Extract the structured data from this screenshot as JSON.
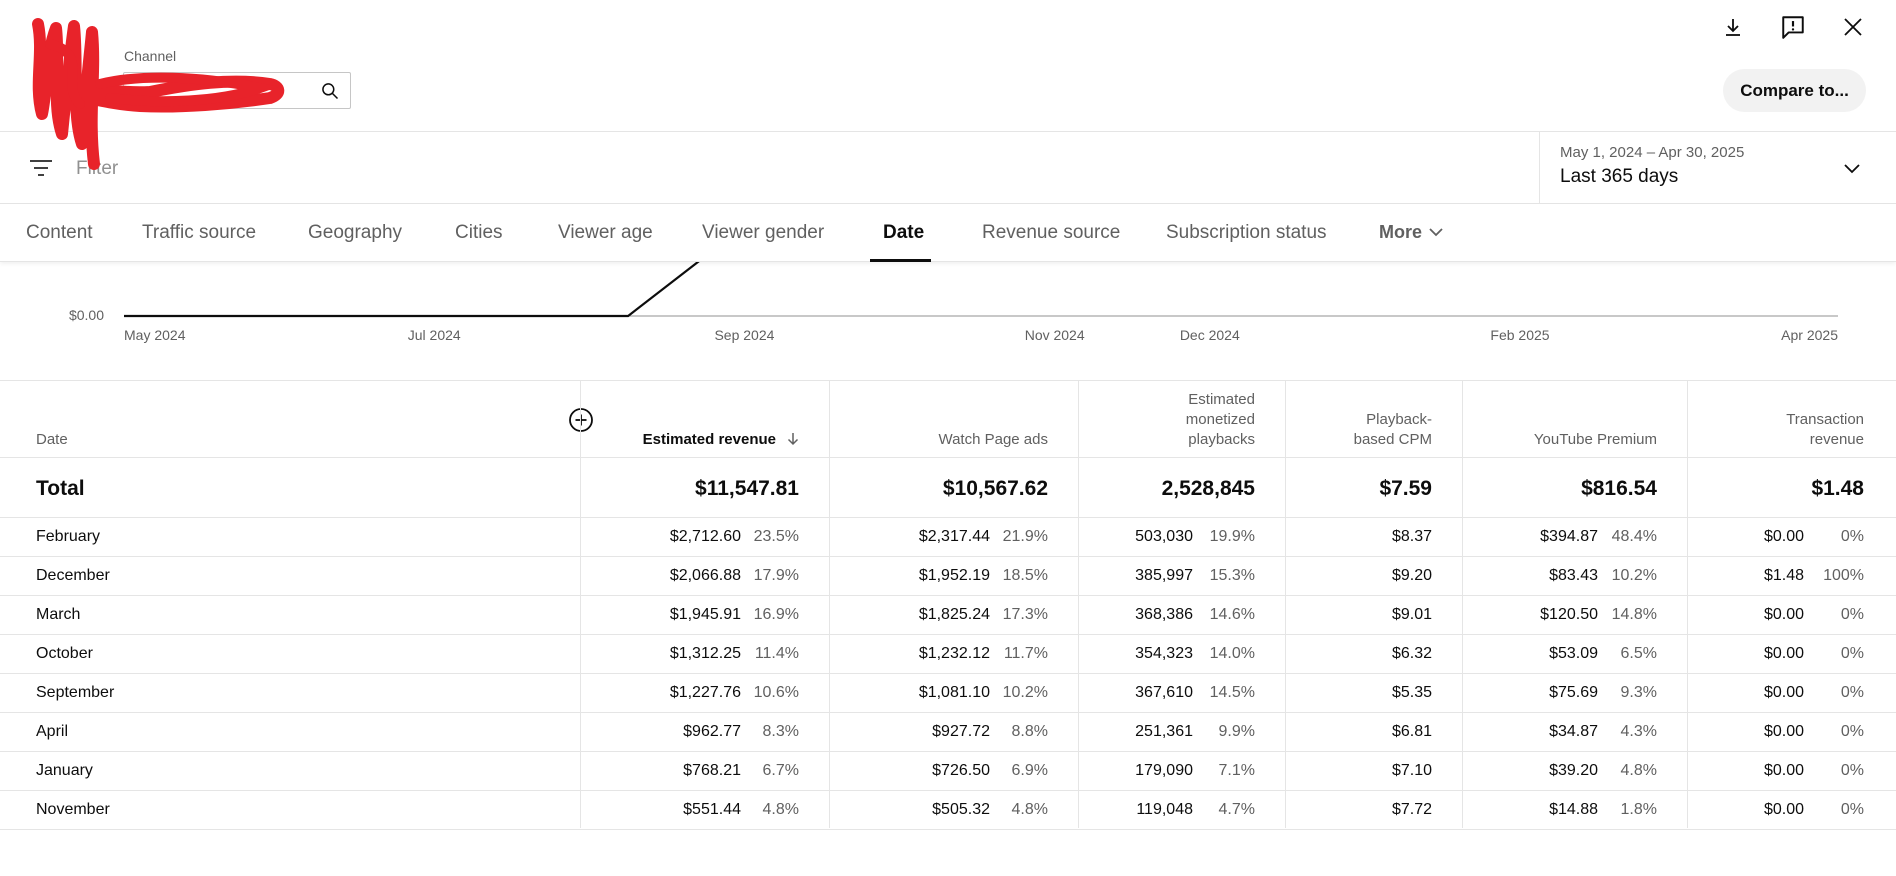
{
  "header": {
    "channel_label": "Channel",
    "channel_value": "",
    "compare_label": "Compare to..."
  },
  "icons": {
    "download": "download-icon",
    "feedback": "feedback-icon",
    "close": "close-icon",
    "search": "search-icon",
    "filter": "filter-icon",
    "chevron": "chevron-down-icon",
    "add_column": "add-circle-icon",
    "sort": "arrow-down-icon"
  },
  "filter": {
    "placeholder": "Filter"
  },
  "date_picker": {
    "range": "May 1, 2024 – Apr 30, 2025",
    "preset": "Last 365 days"
  },
  "tabs": [
    {
      "label": "Content"
    },
    {
      "label": "Traffic source"
    },
    {
      "label": "Geography"
    },
    {
      "label": "Cities"
    },
    {
      "label": "Viewer age"
    },
    {
      "label": "Viewer gender"
    },
    {
      "label": "Date",
      "active": true
    },
    {
      "label": "Revenue source"
    },
    {
      "label": "Subscription status"
    },
    {
      "label": "More"
    }
  ],
  "chart_data": {
    "type": "line",
    "y_tick_labels": [
      "$0.00"
    ],
    "x_tick_labels": [
      "May 2024",
      "Jul 2024",
      "Sep 2024",
      "Nov 2024",
      "Dec 2024",
      "Feb 2025",
      "Apr 2025"
    ],
    "series": [
      {
        "x": [
          "May 2024",
          "Aug 2024",
          "Sep 2024"
        ],
        "values": [
          0,
          0,
          1
        ]
      }
    ]
  },
  "table": {
    "columns": [
      {
        "label": "Date"
      },
      {
        "label": "Estimated revenue",
        "sorted": true
      },
      {
        "label": "Watch Page ads"
      },
      {
        "label": "Estimated monetized playbacks"
      },
      {
        "label": "Playback-based CPM"
      },
      {
        "label": "YouTube Premium"
      },
      {
        "label": "Transaction revenue"
      }
    ],
    "header_lines": {
      "date": [
        "Date"
      ],
      "est_rev": [
        "Estimated revenue"
      ],
      "watch": [
        "Watch Page ads"
      ],
      "playbacks": [
        "Estimated",
        "monetized",
        "playbacks"
      ],
      "cpm": [
        "Playback-",
        "based CPM"
      ],
      "premium": [
        "YouTube Premium"
      ],
      "transaction": [
        "Transaction",
        "revenue"
      ]
    },
    "total": {
      "label": "Total",
      "est_rev": "$11,547.81",
      "watch": "$10,567.62",
      "playbacks": "2,528,845",
      "cpm": "$7.59",
      "premium": "$816.54",
      "transaction": "$1.48"
    },
    "rows": [
      {
        "date": "February",
        "est_rev": "$2,712.60",
        "est_rev_pct": "23.5%",
        "watch": "$2,317.44",
        "watch_pct": "21.9%",
        "playbacks": "503,030",
        "playbacks_pct": "19.9%",
        "cpm": "$8.37",
        "premium": "$394.87",
        "premium_pct": "48.4%",
        "transaction": "$0.00",
        "transaction_pct": "0%"
      },
      {
        "date": "December",
        "est_rev": "$2,066.88",
        "est_rev_pct": "17.9%",
        "watch": "$1,952.19",
        "watch_pct": "18.5%",
        "playbacks": "385,997",
        "playbacks_pct": "15.3%",
        "cpm": "$9.20",
        "premium": "$83.43",
        "premium_pct": "10.2%",
        "transaction": "$1.48",
        "transaction_pct": "100%"
      },
      {
        "date": "March",
        "est_rev": "$1,945.91",
        "est_rev_pct": "16.9%",
        "watch": "$1,825.24",
        "watch_pct": "17.3%",
        "playbacks": "368,386",
        "playbacks_pct": "14.6%",
        "cpm": "$9.01",
        "premium": "$120.50",
        "premium_pct": "14.8%",
        "transaction": "$0.00",
        "transaction_pct": "0%"
      },
      {
        "date": "October",
        "est_rev": "$1,312.25",
        "est_rev_pct": "11.4%",
        "watch": "$1,232.12",
        "watch_pct": "11.7%",
        "playbacks": "354,323",
        "playbacks_pct": "14.0%",
        "cpm": "$6.32",
        "premium": "$53.09",
        "premium_pct": "6.5%",
        "transaction": "$0.00",
        "transaction_pct": "0%"
      },
      {
        "date": "September",
        "est_rev": "$1,227.76",
        "est_rev_pct": "10.6%",
        "watch": "$1,081.10",
        "watch_pct": "10.2%",
        "playbacks": "367,610",
        "playbacks_pct": "14.5%",
        "cpm": "$5.35",
        "premium": "$75.69",
        "premium_pct": "9.3%",
        "transaction": "$0.00",
        "transaction_pct": "0%"
      },
      {
        "date": "April",
        "est_rev": "$962.77",
        "est_rev_pct": "8.3%",
        "watch": "$927.72",
        "watch_pct": "8.8%",
        "playbacks": "251,361",
        "playbacks_pct": "9.9%",
        "cpm": "$6.81",
        "premium": "$34.87",
        "premium_pct": "4.3%",
        "transaction": "$0.00",
        "transaction_pct": "0%"
      },
      {
        "date": "January",
        "est_rev": "$768.21",
        "est_rev_pct": "6.7%",
        "watch": "$726.50",
        "watch_pct": "6.9%",
        "playbacks": "179,090",
        "playbacks_pct": "7.1%",
        "cpm": "$7.10",
        "premium": "$39.20",
        "premium_pct": "4.8%",
        "transaction": "$0.00",
        "transaction_pct": "0%"
      },
      {
        "date": "November",
        "est_rev": "$551.44",
        "est_rev_pct": "4.8%",
        "watch": "$505.32",
        "watch_pct": "4.8%",
        "playbacks": "119,048",
        "playbacks_pct": "4.7%",
        "cpm": "$7.72",
        "premium": "$14.88",
        "premium_pct": "1.8%",
        "transaction": "$0.00",
        "transaction_pct": "0%"
      }
    ]
  }
}
